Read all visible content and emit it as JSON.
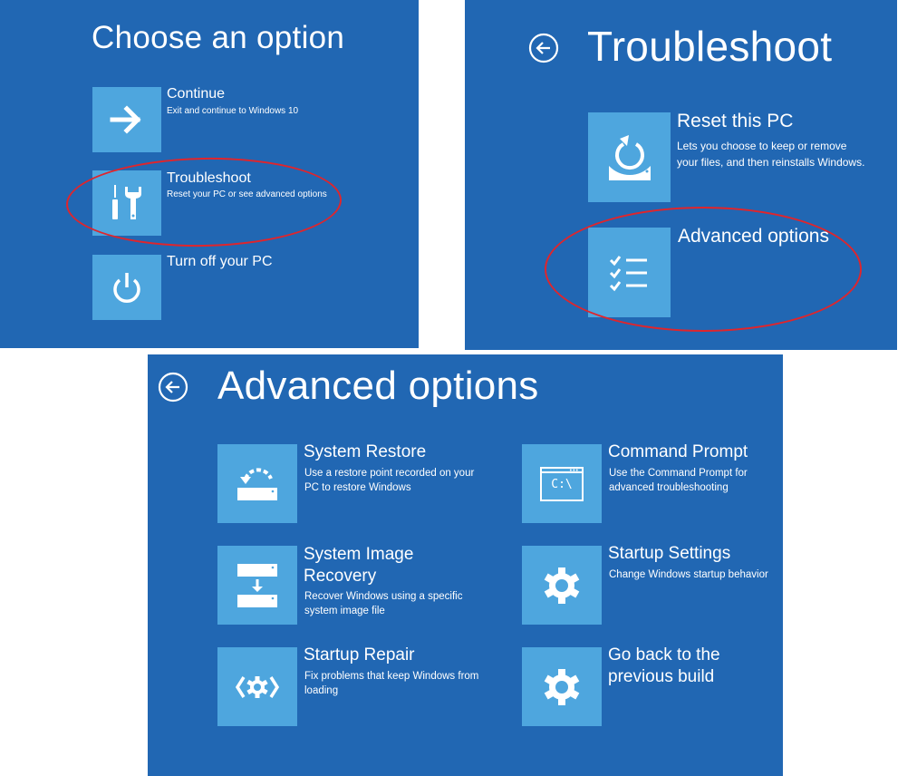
{
  "colors": {
    "background": "#2167b3",
    "tile": "#4ea6de",
    "highlight": "#e0252c",
    "text": "#ffffff"
  },
  "choose_option": {
    "title": "Choose an option",
    "options": [
      {
        "icon": "arrow-right-icon",
        "title": "Continue",
        "desc": "Exit and continue to Windows 10"
      },
      {
        "icon": "tools-icon",
        "title": "Troubleshoot",
        "desc": "Reset your PC or see advanced options",
        "highlighted": true
      },
      {
        "icon": "power-icon",
        "title": "Turn off your PC",
        "desc": ""
      }
    ]
  },
  "troubleshoot": {
    "back_icon": "back-arrow-icon",
    "title": "Troubleshoot",
    "options": [
      {
        "icon": "reset-pc-icon",
        "title": "Reset this PC",
        "desc_line1": "Lets you choose to keep or remove",
        "desc_line2": "your files, and then reinstalls Windows."
      },
      {
        "icon": "checklist-icon",
        "title": "Advanced options",
        "desc_line1": "",
        "desc_line2": "",
        "highlighted": true
      }
    ]
  },
  "advanced_options": {
    "back_icon": "back-arrow-icon",
    "title": "Advanced options",
    "options": [
      {
        "icon": "system-restore-icon",
        "title_line1": "System Restore",
        "title_line2": "",
        "desc_line1": "Use a restore point recorded on your",
        "desc_line2": "PC to restore Windows"
      },
      {
        "icon": "command-prompt-icon",
        "title_line1": "Command Prompt",
        "title_line2": "",
        "desc_line1": "Use the Command Prompt for",
        "desc_line2": "advanced troubleshooting",
        "icon_text": "C:\\"
      },
      {
        "icon": "system-image-icon",
        "title_line1": "System Image",
        "title_line2": "Recovery",
        "desc_line1": "Recover Windows using a specific",
        "desc_line2": "system image file"
      },
      {
        "icon": "gear-icon",
        "title_line1": "Startup Settings",
        "title_line2": "",
        "desc_line1": "Change Windows startup behavior",
        "desc_line2": ""
      },
      {
        "icon": "startup-repair-icon",
        "title_line1": "Startup Repair",
        "title_line2": "",
        "desc_line1": "Fix problems that keep Windows from",
        "desc_line2": "loading"
      },
      {
        "icon": "gear-icon",
        "title_line1": "Go back to the",
        "title_line2": "previous build",
        "desc_line1": "",
        "desc_line2": ""
      }
    ]
  }
}
